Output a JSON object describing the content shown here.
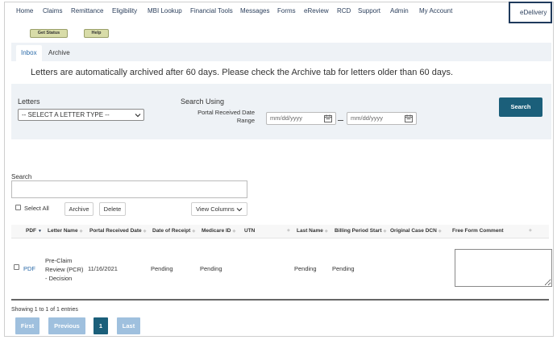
{
  "topnav": {
    "items": [
      "Home",
      "Claims",
      "Remittance",
      "Eligibility",
      "MBI Lookup",
      "Financial Tools",
      "Messages",
      "Forms",
      "eReview",
      "RCD",
      "Support",
      "Admin",
      "My Account"
    ],
    "active_item": "eDelivery"
  },
  "actions": {
    "get_status": "Get Status",
    "help": "Help"
  },
  "tabs": [
    "Inbox",
    "Archive"
  ],
  "notice": "Letters are automatically archived after 60 days.  Please check the Archive tab for letters older than 60 days.",
  "filters": {
    "letters_label": "Letters",
    "letter_type_value": "-- SELECT A LETTER TYPE --",
    "search_using_label": "Search Using",
    "portal_received_label": "Portal Received Date Range",
    "date_from_placeholder": "mm/dd/yyyy",
    "date_to_placeholder": "mm/dd/yyyy",
    "search_button": "Search"
  },
  "search_box": {
    "label": "Search",
    "value": ""
  },
  "bulk": {
    "select_all": "Select All",
    "archive": "Archive",
    "delete": "Delete",
    "view_columns": "View Columns"
  },
  "table": {
    "headers": [
      "PDF",
      "Letter Name",
      "Portal Received Date",
      "Date of Receipt",
      "Medicare ID",
      "UTN",
      "Last Name",
      "Billing Period Start",
      "Original Case DCN",
      "Free Form Comment"
    ],
    "rows": [
      {
        "pdf": "PDF",
        "letter_name_lines": [
          "Pre-Claim",
          "Review (PCR)",
          "- Decision"
        ],
        "portal_received_date": "11/16/2021",
        "date_of_receipt": "Pending",
        "medicare_id": "Pending",
        "utn": "",
        "last_name": "Pending",
        "billing_period_start": "Pending",
        "original_case_dcn": "",
        "comment": ""
      }
    ]
  },
  "footer": {
    "showing": "Showing 1 to 1 of 1 entries",
    "first": "First",
    "previous": "Previous",
    "current_page": "1",
    "last": "Last"
  },
  "colors": {
    "nav_text": "#2b3f5c",
    "primary_button": "#1b5f7a",
    "pager_disabled": "#9fc0de",
    "link": "#2a6aa8",
    "small_button": "#d8dca8",
    "highlight_border": "#1f3a5c"
  },
  "icons": [
    "chevron-down-icon",
    "calendar-icon",
    "sort-icon"
  ]
}
